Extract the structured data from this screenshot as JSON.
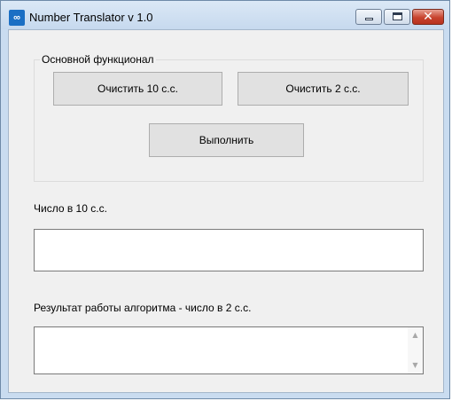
{
  "window": {
    "title": "Number Translator v 1.0",
    "icon": "infinity-app-icon",
    "controls": {
      "minimize_icon": "minimize-icon",
      "maximize_icon": "maximize-icon",
      "close_glyph": "✕"
    }
  },
  "group": {
    "legend": "Основной функционал",
    "clear_decimal_label": "Очистить 10 с.с.",
    "clear_binary_label": "Очистить 2 с.с.",
    "run_label": "Выполнить"
  },
  "decimal_input": {
    "label": "Число в 10 с.с.",
    "value": ""
  },
  "result_output": {
    "label": "Результат работы алгоритма - число в 2 с.с.",
    "value": "",
    "scroll_up": "▲",
    "scroll_down": "▼"
  },
  "colors": {
    "client_background": "#f0f0f0",
    "button_face": "#e1e1e1",
    "close_button": "#c7432e",
    "app_icon": "#1b6fc4"
  }
}
